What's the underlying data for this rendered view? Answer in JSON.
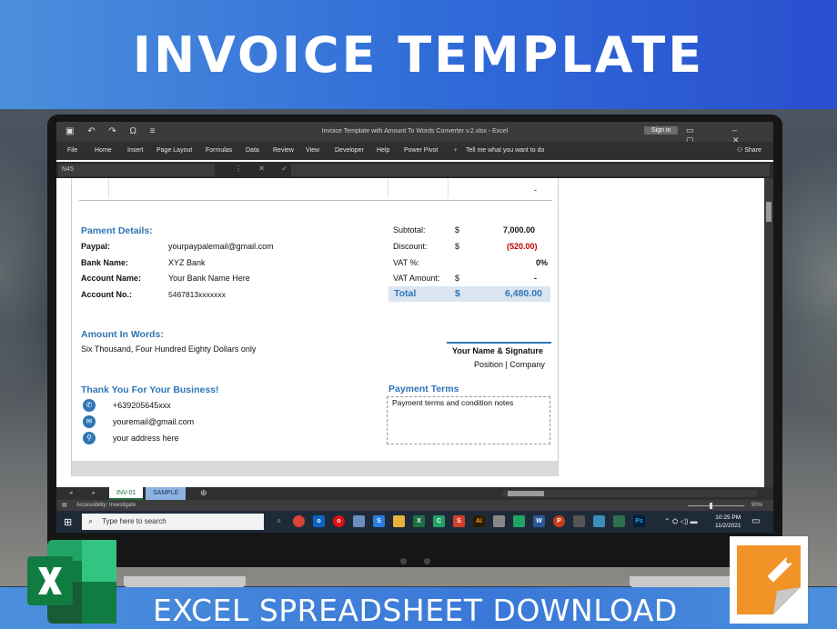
{
  "banner": {
    "top_title": "INVOICE TEMPLATE",
    "bottom_title": "EXCEL SPREADSHEET DOWNLOAD"
  },
  "excel": {
    "window_title": "Invoice Template with Amount To Words Converter v.2.xlsx  -  Excel",
    "sign_in": "Sign in",
    "menu": [
      "File",
      "Home",
      "Insert",
      "Page Layout",
      "Formulas",
      "Data",
      "Review",
      "View",
      "Developer",
      "Help",
      "Power Pivot"
    ],
    "tell_me": "Tell me what you want to do",
    "share": "Share",
    "name_box": "N45",
    "sheet_tabs": [
      "INV-01",
      "SAMPLE"
    ],
    "status_accessibility": "Accessibility: Investigate",
    "zoom": "90%"
  },
  "invoice": {
    "top_dash": "-",
    "payment_details_title": "Pament Details:",
    "paypal_label": "Paypal:",
    "paypal_value": "yourpaypalemail@gmail.com",
    "bank_name_label": "Bank Name:",
    "bank_name_value": "XYZ Bank",
    "account_name_label": "Account Name:",
    "account_name_value": "Your Bank Name Here",
    "account_no_label": "Account No.:",
    "account_no_value": "5467813xxxxxxx",
    "subtotal_label": "Subtotal:",
    "subtotal_currency": "$",
    "subtotal_value": "7,000.00",
    "discount_label": "Discount:",
    "discount_currency": "$",
    "discount_value": "(520.00)",
    "vat_pct_label": "VAT %:",
    "vat_pct_value": "0%",
    "vat_amount_label": "VAT Amount:",
    "vat_amount_currency": "$",
    "vat_amount_value": "-",
    "total_label": "Total",
    "total_currency": "$",
    "total_value": "6,480.00",
    "amount_words_title": "Amount In Words:",
    "amount_words_value": "Six Thousand, Four Hundred Eighty Dollars only",
    "signature_name": "Your Name & Signature",
    "signature_position": "Position | Company",
    "thank_you": "Thank You For Your Business!",
    "phone": "+639205645xxx",
    "email": "youremail@gmail.com",
    "address": "your address here",
    "payment_terms_title": "Payment Terms",
    "payment_terms_note": "Payment terms and condition notes"
  },
  "taskbar": {
    "search_placeholder": "Type here to search",
    "time": "10:25 PM",
    "date": "11/2/2021"
  },
  "colors": {
    "accent_blue": "#2e75b6",
    "discount_red": "#c00000",
    "excel_green": "#1e6b3a"
  },
  "icons": [
    "windows-start-icon",
    "search-icon",
    "phone-icon",
    "email-icon",
    "location-icon",
    "excel-logo-icon",
    "brand-logo-icon"
  ]
}
